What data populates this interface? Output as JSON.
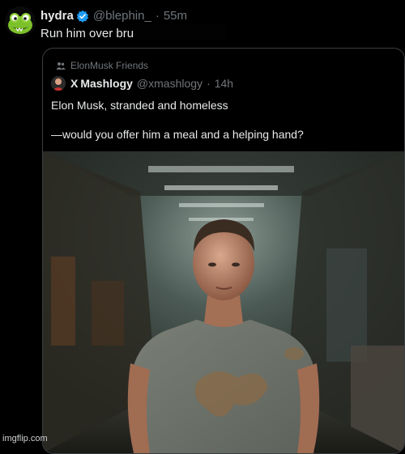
{
  "reply": {
    "display_name": "hydra",
    "handle": "@blephin_",
    "separator": "·",
    "time": "55m",
    "text": "Run him over bruh",
    "avatar_icon": "green-frog-character-icon",
    "verified_icon": "verified-badge-icon",
    "verified_color": "#1d9bf0"
  },
  "quote": {
    "community_icon": "community-people-icon",
    "community": "ElonMusk Friends",
    "x_logo": "X",
    "display_name": "Mashlogy",
    "handle": "@xmashlogy",
    "separator": "·",
    "time": "14h",
    "line1": "Elon Musk, stranded and homeless",
    "line2": "—would you offer him a meal and a helping hand?",
    "image_icon": "man-in-stained-tshirt-in-warehouse-image"
  },
  "watermark": "imgflip.com",
  "colors": {
    "background": "#000000",
    "text": "#e7e9ea",
    "muted": "#71767b",
    "border": "#3b3f43"
  }
}
